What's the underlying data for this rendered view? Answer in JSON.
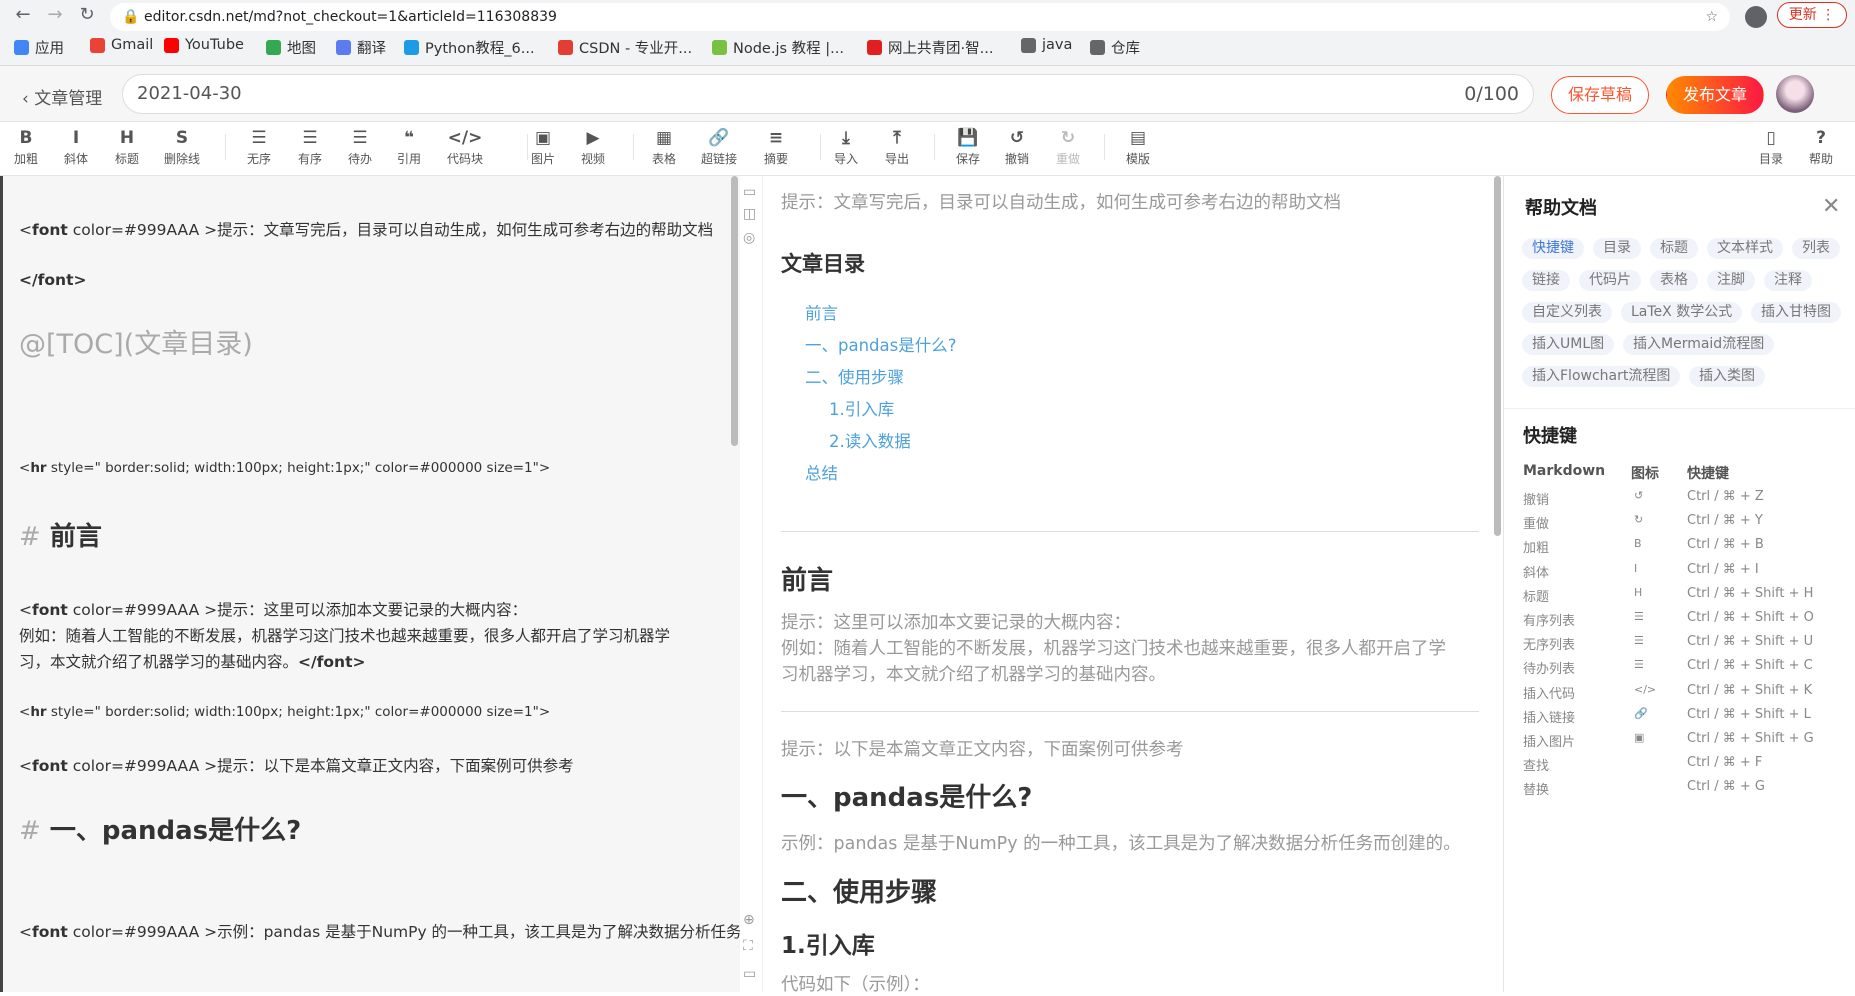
{
  "browser": {
    "url": "editor.csdn.net/md?not_checkout=1&articleId=116308839",
    "update_label": "更新",
    "bookmarks": [
      {
        "label": "应用",
        "color": "#4285f4"
      },
      {
        "label": "Gmail",
        "color": "#ea4335"
      },
      {
        "label": "YouTube",
        "color": "#ff0000"
      },
      {
        "label": "地图",
        "color": "#34a853"
      },
      {
        "label": "翻译",
        "color": "#5b7cf0"
      },
      {
        "label": "Python教程_6...",
        "color": "#1e9be6"
      },
      {
        "label": "CSDN - 专业开...",
        "color": "#e33e33"
      },
      {
        "label": "Node.js 教程 |...",
        "color": "#7ac143"
      },
      {
        "label": "网上共青团·智...",
        "color": "#e02020"
      },
      {
        "label": "java",
        "color": "#666"
      },
      {
        "label": "仓库",
        "color": "#666"
      }
    ]
  },
  "header": {
    "back_label": "文章管理",
    "title_value": "2021-04-30",
    "char_count": "0/100",
    "save_draft": "保存草稿",
    "publish": "发布文章"
  },
  "toolbar": [
    {
      "icon": "B",
      "label": "加粗",
      "name": "bold"
    },
    {
      "icon": "I",
      "label": "斜体",
      "name": "italic"
    },
    {
      "icon": "H",
      "label": "标题",
      "name": "heading"
    },
    {
      "icon": "S",
      "label": "删除线",
      "name": "strikethrough"
    },
    {
      "icon": "☰",
      "label": "无序",
      "name": "unordered-list"
    },
    {
      "icon": "☰",
      "label": "有序",
      "name": "ordered-list"
    },
    {
      "icon": "☰",
      "label": "待办",
      "name": "todo-list"
    },
    {
      "icon": "❝",
      "label": "引用",
      "name": "quote"
    },
    {
      "icon": "</>",
      "label": "代码块",
      "name": "code-block"
    },
    {
      "icon": "▣",
      "label": "图片",
      "name": "image"
    },
    {
      "icon": "▶",
      "label": "视频",
      "name": "video"
    },
    {
      "icon": "▦",
      "label": "表格",
      "name": "table"
    },
    {
      "icon": "🔗",
      "label": "超链接",
      "name": "link"
    },
    {
      "icon": "≡",
      "label": "摘要",
      "name": "summary"
    },
    {
      "icon": "⤓",
      "label": "导入",
      "name": "import"
    },
    {
      "icon": "⤒",
      "label": "导出",
      "name": "export"
    },
    {
      "icon": "💾",
      "label": "保存",
      "name": "save"
    },
    {
      "icon": "↺",
      "label": "撤销",
      "name": "undo"
    },
    {
      "icon": "↻",
      "label": "重做",
      "name": "redo",
      "disabled": true
    },
    {
      "icon": "▤",
      "label": "模版",
      "name": "template"
    },
    {
      "icon": "▯",
      "label": "目录",
      "name": "toc"
    },
    {
      "icon": "?",
      "label": "帮助",
      "name": "help"
    }
  ],
  "editor": {
    "lines": [
      {
        "attr": " color=#999AAA >",
        "text": "提示：文章写完后，目录可以自动生成，如何生成可参考右边的帮助文档"
      },
      {
        "closing": "</font>"
      },
      {
        "toc": "@[TOC](文章目录)"
      },
      {
        "hr_kw": "hr",
        "hr_attr": " style=\" border:solid; width:100px; height:1px;\" color=#000000 size=1\">"
      },
      {
        "heading": "前言"
      },
      {
        "attr": " color=#999AAA >",
        "text": "提示：这里可以添加本文要记录的大概内容："
      },
      {
        "text": "例如：随着人工智能的不断发展，机器学习这门技术也越来越重要，很多人都开启了学习机器学"
      },
      {
        "text": "习，本文就介绍了机器学习的基础内容。",
        "closing": "</font>"
      },
      {
        "hr_kw": "hr",
        "hr_attr": " style=\" border:solid; width:100px; height:1px;\" color=#000000 size=1\">"
      },
      {
        "attr": " color=#999AAA >",
        "text": "提示：以下是本篇文章正文内容，下面案例可供参考"
      },
      {
        "heading": "一、pandas是什么?"
      },
      {
        "attr": " color=#999AAA >",
        "text": "示例：pandas 是基于NumPy 的一种工具，该工具是为了解决数据分析任务而创建的。"
      }
    ],
    "hash": "#",
    "lt": "<",
    "font_kw": "font"
  },
  "preview": {
    "hint1": "提示：文章写完后，目录可以自动生成，如何生成可参考右边的帮助文档",
    "toc_title": "文章目录",
    "toc": [
      "前言",
      "一、pandas是什么?",
      "二、使用步骤",
      "1.引入库",
      "2.读入数据",
      "总结"
    ],
    "h_preface": "前言",
    "p1": "提示：这里可以添加本文要记录的大概内容：",
    "p2": "例如：随着人工智能的不断发展，机器学习这门技术也越来越重要，很多人都开启了学",
    "p3": "习机器学习，本文就介绍了机器学习的基础内容。",
    "hint2": "提示：以下是本篇文章正文内容，下面案例可供参考",
    "h1": "一、pandas是什么?",
    "p4": "示例：pandas 是基于NumPy 的一种工具，该工具是为了解决数据分析任务而创建的。",
    "h2": "二、使用步骤",
    "h3": "1.引入库",
    "p5": "代码如下（示例）："
  },
  "help": {
    "title": "帮助文档",
    "tags": [
      "快捷键",
      "目录",
      "标题",
      "文本样式",
      "列表",
      "链接",
      "代码片",
      "表格",
      "注脚",
      "注释",
      "自定义列表",
      "LaTeX 数学公式",
      "插入甘特图",
      "插入UML图",
      "插入Mermaid流程图",
      "插入Flowchart流程图",
      "插入类图"
    ],
    "shortcut_title": "快捷键",
    "columns": [
      "Markdown",
      "图标",
      "快捷键"
    ],
    "rows": [
      [
        "撤销",
        "↺",
        "Ctrl / ⌘ + Z"
      ],
      [
        "重做",
        "↻",
        "Ctrl / ⌘ + Y"
      ],
      [
        "加粗",
        "B",
        "Ctrl / ⌘ + B"
      ],
      [
        "斜体",
        "I",
        "Ctrl / ⌘ + I"
      ],
      [
        "标题",
        "H",
        "Ctrl / ⌘ + Shift + H"
      ],
      [
        "有序列表",
        "☰",
        "Ctrl / ⌘ + Shift + O"
      ],
      [
        "无序列表",
        "☰",
        "Ctrl / ⌘ + Shift + U"
      ],
      [
        "待办列表",
        "☰",
        "Ctrl / ⌘ + Shift + C"
      ],
      [
        "插入代码",
        "</>",
        "Ctrl / ⌘ + Shift + K"
      ],
      [
        "插入链接",
        "🔗",
        "Ctrl / ⌘ + Shift + L"
      ],
      [
        "插入图片",
        "▣",
        "Ctrl / ⌘ + Shift + G"
      ],
      [
        "查找",
        "",
        "Ctrl / ⌘ + F"
      ],
      [
        "替换",
        "",
        "Ctrl / ⌘ + G"
      ]
    ]
  },
  "colors": {
    "accent": "#fc5531",
    "link": "#4ea1db",
    "tag_active": "#3e78d6"
  }
}
